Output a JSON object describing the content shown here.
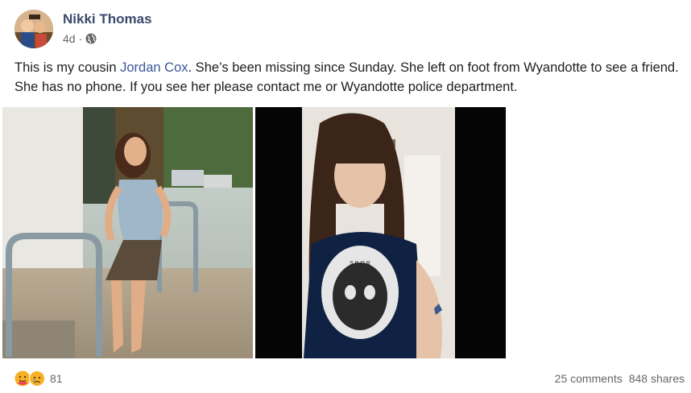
{
  "post": {
    "author": "Nikki Thomas",
    "time": "4d",
    "separator": "·",
    "privacy_icon": "globe-icon",
    "text_before_link": "This is my cousin ",
    "mention": "Jordan Cox",
    "text_after_link": ". She’s been missing since Sunday. She left on foot from Wyandotte to see a friend. She has no phone. If you see her please contact me or Wyandotte police department.",
    "photos": [
      {
        "name": "photo-1",
        "subject": "woman-standing-outdoors"
      },
      {
        "name": "photo-2",
        "subject": "woman-selfie-indoors"
      }
    ],
    "photo_print": "S.B.O.R"
  },
  "footer": {
    "reaction_icons": [
      "care-reaction-icon",
      "sad-reaction-icon"
    ],
    "reaction_count": "81",
    "comments": "25 comments",
    "shares": "848 shares"
  },
  "colors": {
    "link": "#385898",
    "muted": "#65676b",
    "text": "#1c1e21"
  }
}
